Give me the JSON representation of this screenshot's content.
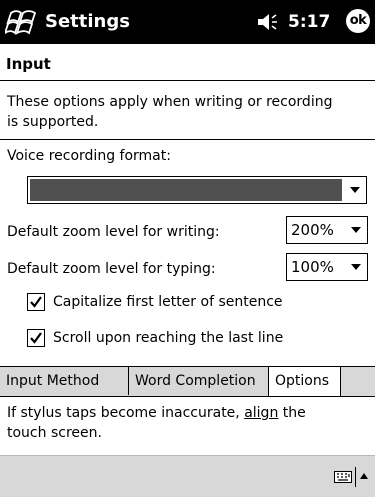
{
  "titlebar": {
    "title": "Settings",
    "time": "5:17",
    "ok_label": "ok",
    "start_icon": "windows-flag-icon",
    "volume_icon": "volume-icon"
  },
  "page": {
    "heading": "Input",
    "description": "These options apply when writing or recording is supported."
  },
  "voice": {
    "label": "Voice recording format:",
    "value": ""
  },
  "zoom_writing": {
    "label": "Default zoom level for writing:",
    "value": "200%"
  },
  "zoom_typing": {
    "label": "Default zoom level for typing:",
    "value": "100%"
  },
  "checkboxes": [
    {
      "label": "Capitalize first letter of sentence",
      "checked": true
    },
    {
      "label": "Scroll upon reaching the last line",
      "checked": true
    }
  ],
  "tabs": [
    {
      "label": "Input Method",
      "active": false
    },
    {
      "label": "Word Completion",
      "active": false
    },
    {
      "label": "Options",
      "active": true
    }
  ],
  "footer": {
    "text_before": "If stylus taps become inaccurate, ",
    "link": "align",
    "text_after": " the touch screen."
  },
  "bottombar": {
    "keyboard_icon": "keyboard-icon",
    "sip_icon": "sip-arrow-up-icon"
  },
  "colors": {
    "titlebar": "#000000",
    "bar_gray": "#d8d8d8",
    "select_fill": "#505050"
  }
}
